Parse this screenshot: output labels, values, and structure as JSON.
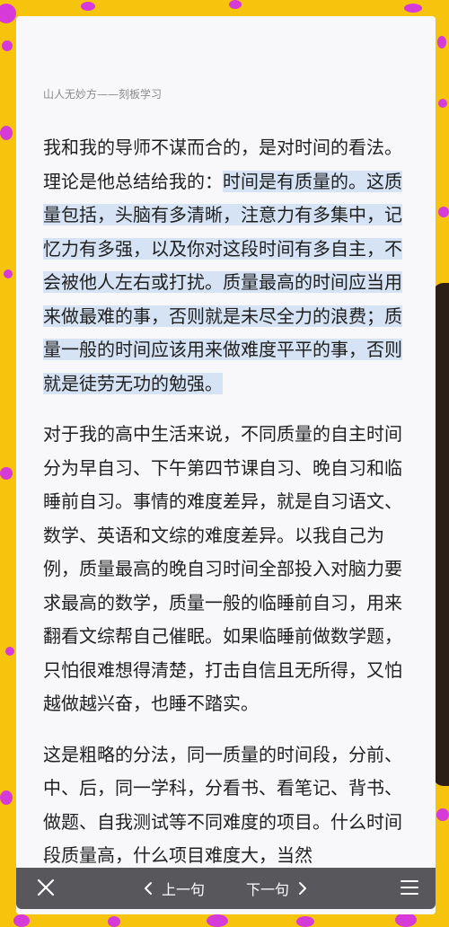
{
  "header": {
    "book_title": "山人无妙方——刻板学习"
  },
  "paragraphs": [
    {
      "before": "我和我的导师不谋而合的，是对时间的看法。理论是他总结给我的：",
      "highlight": "时间是有质量的。这质量包括，头脑有多清晰，注意力有多集中，记忆力有多强，以及你对这段时间有多自主，不会被他人左右或打扰。质量最高的时间应当用来做最难的事，否则就是未尽全力的浪费；质量一般的时间应该用来做难度平平的事，否则就是徒劳无功的勉强。"
    },
    {
      "text": "对于我的高中生活来说，不同质量的自主时间分为早自习、下午第四节课自习、晚自习和临睡前自习。事情的难度差异，就是自习语文、数学、英语和文综的难度差异。以我自己为例，质量最高的晚自习时间全部投入对脑力要求最高的数学，质量一般的临睡前自习，用来翻看文综帮自己催眠。如果临睡前做数学题，只怕很难想得清楚，打击自信且无所得，又怕越做越兴奋，也睡不踏实。"
    },
    {
      "text": "这是粗略的分法，同一质量的时间段，分前、中、后，同一学科，分看书、看笔记、背书、做题、自我测试等不同难度的项目。什么时间段质量高，什么项目难度大，当然"
    }
  ],
  "bottom_bar": {
    "close_icon": "close-icon",
    "prev_label": "上一句",
    "next_label": "下一句",
    "menu_icon": "menu-icon"
  },
  "colors": {
    "background": "#F6C40C",
    "page": "#F8F8FA",
    "highlight": "#D5E3F5",
    "bar": "#58585C"
  }
}
